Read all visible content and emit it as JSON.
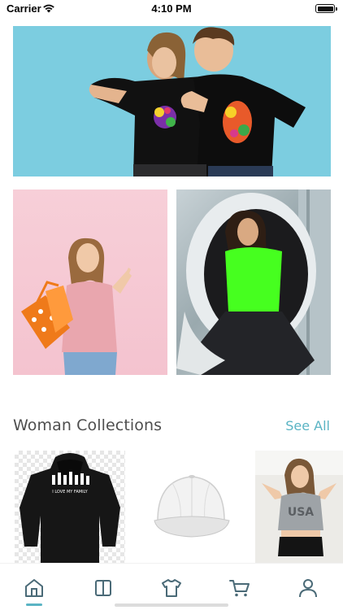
{
  "status_bar": {
    "carrier": "Carrier",
    "time": "4:10 PM"
  },
  "banners": {
    "hero": {
      "description_icon": "couple-black-tshirts-photo"
    },
    "promo_left": {
      "description_icon": "woman-pink-tshirt-shopping-bags-photo"
    },
    "promo_right": {
      "description_icon": "woman-green-tshirt-egg-chair-photo"
    }
  },
  "section": {
    "title": "Woman Collections",
    "see_all": "See All"
  },
  "products": [
    {
      "icon": "black-hoodie-photo",
      "print_text": "I LOVE MY FAMILY"
    },
    {
      "icon": "white-cap-photo"
    },
    {
      "icon": "usa-crop-top-photo",
      "print_text": "USA"
    }
  ],
  "tab_bar": {
    "items": [
      {
        "icon": "home-icon",
        "active": true
      },
      {
        "icon": "book-icon",
        "active": false
      },
      {
        "icon": "tshirt-icon",
        "active": false
      },
      {
        "icon": "cart-icon",
        "active": false
      },
      {
        "icon": "profile-icon",
        "active": false
      }
    ],
    "active_color": "#5ab4c4",
    "inactive_color": "#4a6a77"
  },
  "colors": {
    "accent": "#5ab4c4",
    "hero_bg": "#7ccde0",
    "section_title": "#4e4e4e"
  }
}
